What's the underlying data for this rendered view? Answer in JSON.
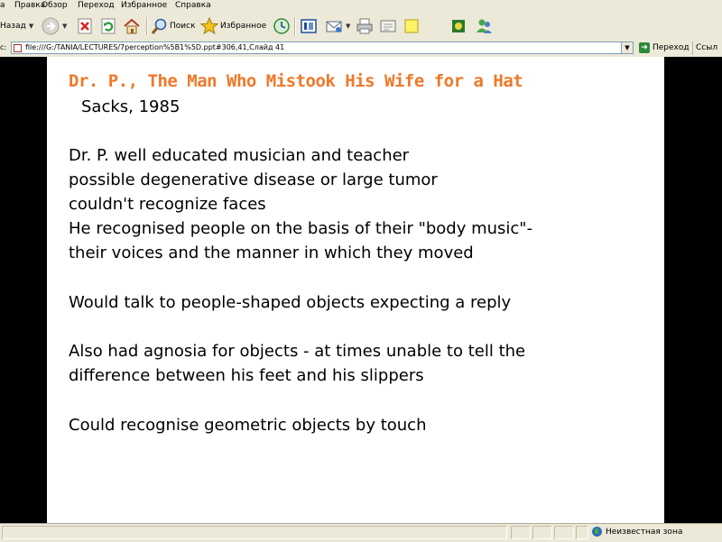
{
  "menu": [
    "a",
    "Правка",
    "Обзор",
    "Переход",
    "Избранное",
    "Справка"
  ],
  "toolbar": {
    "back_label": "Назад",
    "search_label": "Поиск",
    "favorites_label": "Избранное"
  },
  "address": {
    "label": "c:",
    "url": "file:///G:/TANIA/LECTURES/7perception%5B1%5D.ppt#306,41,Слайд 41",
    "go_label": "Переход",
    "links_label": "Ссыл"
  },
  "slide": {
    "title": "Dr. P., The Man Who Mistook His Wife for a Hat",
    "subtitle": "Sacks, 1985",
    "lines": [
      "Dr. P. well educated musician and teacher",
      "possible degenerative disease or large tumor",
      "couldn't recognize faces",
      "He recognised people on the basis of their \"body music\"-",
      "their voices and the manner in which they moved",
      "Would talk to people-shaped objects expecting a reply",
      "Also had agnosia for objects -  at times unable to tell the",
      "difference between his feet and his slippers",
      "Could recognise geometric objects by touch"
    ]
  },
  "status": {
    "zone": "Неизвестная зона"
  },
  "icons": {
    "back": "back-arrow-icon",
    "forward": "forward-arrow-icon",
    "stop": "stop-icon",
    "refresh": "refresh-icon",
    "home": "home-icon",
    "search": "search-icon",
    "favorites": "favorites-star-icon",
    "media": "media-icon",
    "history": "history-icon",
    "mail": "mail-icon",
    "print": "print-icon",
    "edit": "edit-icon",
    "discuss": "discuss-icon",
    "messenger": "messenger-icon",
    "go": "go-arrow-icon",
    "zone": "globe-icon"
  },
  "colors": {
    "title": "#f07828",
    "frame": "#000000",
    "chrome": "#ece9d8"
  }
}
